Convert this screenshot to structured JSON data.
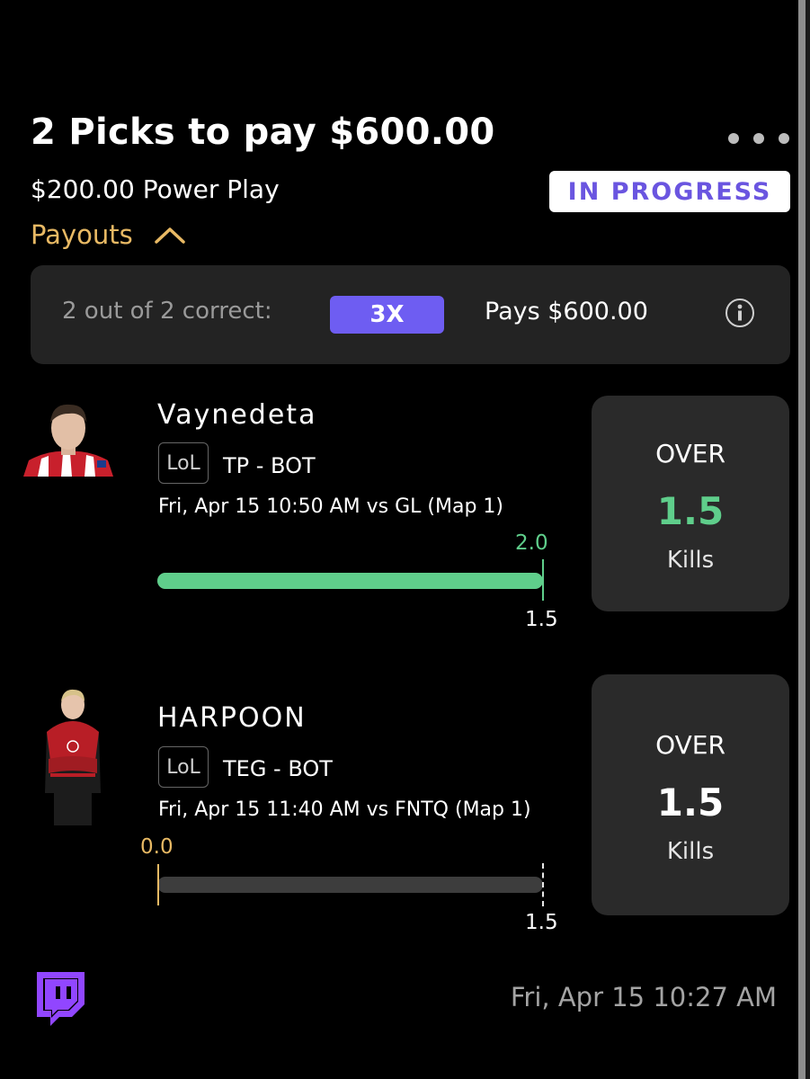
{
  "header": {
    "title": "2 Picks to pay $600.00",
    "subtitle": "$200.00 Power Play",
    "status_badge": "IN PROGRESS",
    "payouts_label": "Payouts"
  },
  "payout_summary": {
    "correct_text": "2 out of 2 correct:",
    "multiplier": "3X",
    "pays_text": "Pays $600.00"
  },
  "picks": [
    {
      "player": "Vaynedeta",
      "game": "LoL",
      "team": "TP - BOT",
      "schedule": "Fri, Apr 15 10:50 AM  vs GL (Map 1)",
      "current_value": "2.0",
      "line_value": "1.5",
      "progress_fraction": 1.0,
      "direction": "OVER",
      "line": "1.5",
      "stat": "Kills",
      "line_color": "#5fce8b"
    },
    {
      "player": "HARPOON",
      "game": "LoL",
      "team": "TEG - BOT",
      "schedule": "Fri, Apr 15 11:40 AM  vs FNTQ (Map 1)",
      "current_value": "0.0",
      "line_value": "1.5",
      "progress_fraction": 0.0,
      "direction": "OVER",
      "line": "1.5",
      "stat": "Kills",
      "line_color": "#ffffff"
    }
  ],
  "footer": {
    "timestamp": "Fri, Apr 15 10:27 AM",
    "icon": "twitch-icon"
  },
  "colors": {
    "accent_purple": "#6e5df2",
    "payouts_gold": "#e8b964",
    "progress_green": "#5fce8b"
  }
}
